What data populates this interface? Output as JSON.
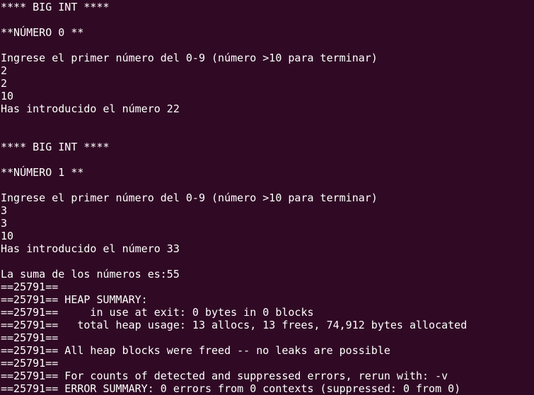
{
  "terminal": {
    "background": "#300a24",
    "foreground": "#ffffff",
    "lines": [
      "**** BIG INT ****",
      "",
      "**NÚMERO 0 **",
      "",
      "Ingrese el primer número del 0-9 (número >10 para terminar)",
      "2",
      "2",
      "10",
      "Has introducido el número 22",
      "",
      "",
      "**** BIG INT ****",
      "",
      "**NÚMERO 1 **",
      "",
      "Ingrese el primer número del 0-9 (número >10 para terminar)",
      "3",
      "3",
      "10",
      "Has introducido el número 33",
      "",
      "La suma de los números es:55",
      "==25791==",
      "==25791== HEAP SUMMARY:",
      "==25791==     in use at exit: 0 bytes in 0 blocks",
      "==25791==   total heap usage: 13 allocs, 13 frees, 74,912 bytes allocated",
      "==25791==",
      "==25791== All heap blocks were freed -- no leaks are possible",
      "==25791==",
      "==25791== For counts of detected and suppressed errors, rerun with: -v",
      "==25791== ERROR SUMMARY: 0 errors from 0 contexts (suppressed: 0 from 0)"
    ]
  }
}
